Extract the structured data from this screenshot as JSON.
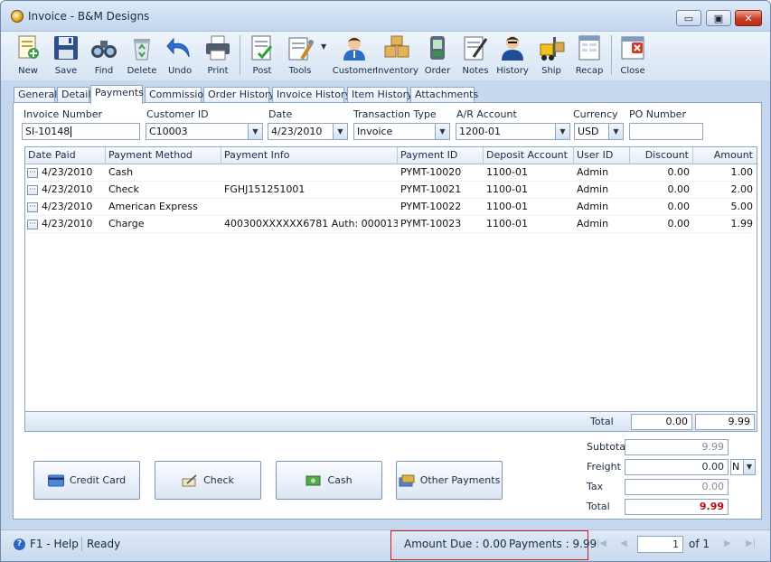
{
  "window": {
    "title": "Invoice - B&M Designs",
    "min_glyph": "▭",
    "max_glyph": "▣",
    "close_glyph": "✕"
  },
  "toolbar": {
    "items": [
      {
        "label": "New",
        "icon": "new-document-icon"
      },
      {
        "label": "Save",
        "icon": "floppy-disk-icon"
      },
      {
        "label": "Find",
        "icon": "binoculars-icon"
      },
      {
        "label": "Delete",
        "icon": "recycle-bin-icon"
      },
      {
        "label": "Undo",
        "icon": "undo-arrow-icon"
      },
      {
        "label": "Print",
        "icon": "printer-icon"
      },
      {
        "label": "Post",
        "icon": "post-checklist-icon"
      },
      {
        "label": "Tools",
        "icon": "tools-icon"
      },
      {
        "label": "Customer",
        "icon": "customer-icon"
      },
      {
        "label": "Inventory",
        "icon": "boxes-icon"
      },
      {
        "label": "Order",
        "icon": "order-device-icon"
      },
      {
        "label": "Notes",
        "icon": "notes-pencil-icon"
      },
      {
        "label": "History",
        "icon": "history-person-icon"
      },
      {
        "label": "Ship",
        "icon": "forklift-icon"
      },
      {
        "label": "Recap",
        "icon": "recap-sheet-icon"
      },
      {
        "label": "Close",
        "icon": "close-window-icon"
      }
    ]
  },
  "tabs": [
    "General",
    "Detail",
    "Payments",
    "Commission",
    "Order History",
    "Invoice History",
    "Item History",
    "Attachments"
  ],
  "active_tab": "Payments",
  "header_fields": {
    "invoice_number": {
      "label": "Invoice Number",
      "value": "SI-10148"
    },
    "customer_id": {
      "label": "Customer ID",
      "value": "C10003"
    },
    "date": {
      "label": "Date",
      "value": "4/23/2010"
    },
    "transaction_type": {
      "label": "Transaction Type",
      "value": "Invoice"
    },
    "ar_account": {
      "label": "A/R Account",
      "value": "1200-01"
    },
    "currency": {
      "label": "Currency",
      "value": "USD"
    },
    "po_number": {
      "label": "PO Number",
      "value": ""
    }
  },
  "grid": {
    "columns": [
      "Date Paid",
      "Payment Method",
      "Payment Info",
      "Payment ID",
      "Deposit Account",
      "User ID",
      "Discount",
      "Amount"
    ],
    "rows": [
      {
        "date_paid": "4/23/2010",
        "method": "Cash",
        "info": "",
        "payment_id": "PYMT-10020",
        "deposit_account": "1100-01",
        "user_id": "Admin",
        "discount": "0.00",
        "amount": "1.00"
      },
      {
        "date_paid": "4/23/2010",
        "method": "Check",
        "info": "FGHJ151251001",
        "payment_id": "PYMT-10021",
        "deposit_account": "1100-01",
        "user_id": "Admin",
        "discount": "0.00",
        "amount": "2.00"
      },
      {
        "date_paid": "4/23/2010",
        "method": "American Express",
        "info": "",
        "payment_id": "PYMT-10022",
        "deposit_account": "1100-01",
        "user_id": "Admin",
        "discount": "0.00",
        "amount": "5.00"
      },
      {
        "date_paid": "4/23/2010",
        "method": "Charge",
        "info": "400300XXXXXX6781 Auth: 000013",
        "payment_id": "PYMT-10023",
        "deposit_account": "1100-01",
        "user_id": "Admin",
        "discount": "0.00",
        "amount": "1.99"
      }
    ],
    "row_button": "···",
    "footer": {
      "label": "Total",
      "discount_total": "0.00",
      "amount_total": "9.99"
    }
  },
  "payment_buttons": [
    {
      "label": "Credit Card",
      "icon": "credit-card-icon"
    },
    {
      "label": "Check",
      "icon": "check-pen-icon"
    },
    {
      "label": "Cash",
      "icon": "cash-bills-icon"
    },
    {
      "label": "Other Payments",
      "icon": "other-payments-icon"
    }
  ],
  "summary": {
    "subtotal": {
      "label": "Subtotal",
      "value": "9.99"
    },
    "freight": {
      "label": "Freight",
      "value": "0.00",
      "term": "N"
    },
    "tax": {
      "label": "Tax",
      "value": "0.00"
    },
    "total": {
      "label": "Total",
      "value": "9.99"
    }
  },
  "statusbar": {
    "help": "F1 - Help",
    "status": "Ready",
    "amount_due": "Amount Due : 0.00",
    "payments": "Payments : 9.99",
    "page": "1",
    "of_pages": "of 1",
    "nav_first": "|◀",
    "nav_prev": "◀",
    "nav_next": "▶",
    "nav_last": "▶|"
  },
  "colors": {
    "accent_border": "#8ea5c4",
    "highlight_red": "#d21a1a",
    "total_red": "#b01212"
  }
}
